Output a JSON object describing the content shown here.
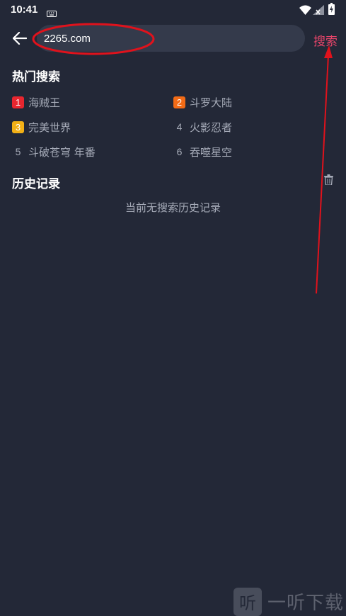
{
  "status": {
    "time": "10:41"
  },
  "search": {
    "value": "2265.com",
    "button_label": "搜索"
  },
  "hot": {
    "title": "热门搜索",
    "items": [
      {
        "rank": "1",
        "label": "海贼王",
        "badge_color": "#e8262f"
      },
      {
        "rank": "2",
        "label": "斗罗大陆",
        "badge_color": "#f26b16"
      },
      {
        "rank": "3",
        "label": "完美世界",
        "badge_color": "#f2b016"
      },
      {
        "rank": "4",
        "label": "火影忍者"
      },
      {
        "rank": "5",
        "label": "斗破苍穹 年番"
      },
      {
        "rank": "6",
        "label": "吞噬星空"
      }
    ]
  },
  "history": {
    "title": "历史记录",
    "empty_text": "当前无搜索历史记录"
  },
  "watermark": {
    "badge": "听",
    "text": "一听下载"
  },
  "colors": {
    "background": "#232837",
    "accent": "#e8456a",
    "annotation": "#e0121c"
  }
}
